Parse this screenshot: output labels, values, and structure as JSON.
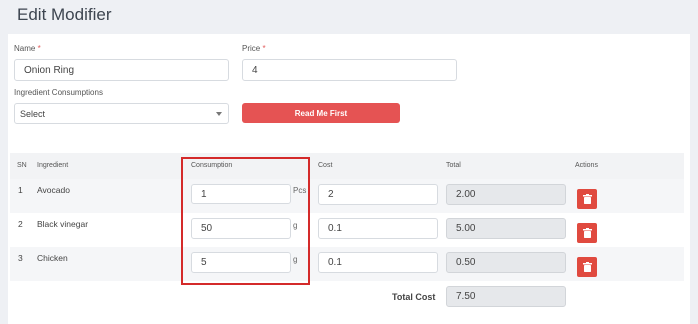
{
  "page": {
    "title": "Edit Modifier"
  },
  "form": {
    "name_label": "Name",
    "name_value": "Onion Ring",
    "price_label": "Price",
    "price_value": "4",
    "required_mark": "*",
    "ingredient_label": "Ingredient Consumptions",
    "select_value": "Select",
    "read_me_label": "Read Me First"
  },
  "table": {
    "headers": {
      "sn": "SN",
      "ingredient": "Ingredient",
      "consumption": "Consumption",
      "cost": "Cost",
      "total": "Total",
      "actions": "Actions"
    },
    "rows": [
      {
        "sn": "1",
        "ingredient": "Avocado",
        "consumption": "1",
        "unit": "Pcs",
        "cost": "2",
        "total": "2.00"
      },
      {
        "sn": "2",
        "ingredient": "Black vinegar",
        "consumption": "50",
        "unit": "g",
        "cost": "0.1",
        "total": "5.00"
      },
      {
        "sn": "3",
        "ingredient": "Chicken",
        "consumption": "5",
        "unit": "g",
        "cost": "0.1",
        "total": "0.50"
      }
    ],
    "total_cost_label": "Total Cost",
    "total_cost_value": "7.50"
  },
  "icons": {
    "delete": "trash-icon",
    "dropdown": "chevron-down-icon"
  },
  "colors": {
    "accent": "#e55353",
    "highlight": "#d42a2a",
    "delete": "#e04a3f"
  }
}
